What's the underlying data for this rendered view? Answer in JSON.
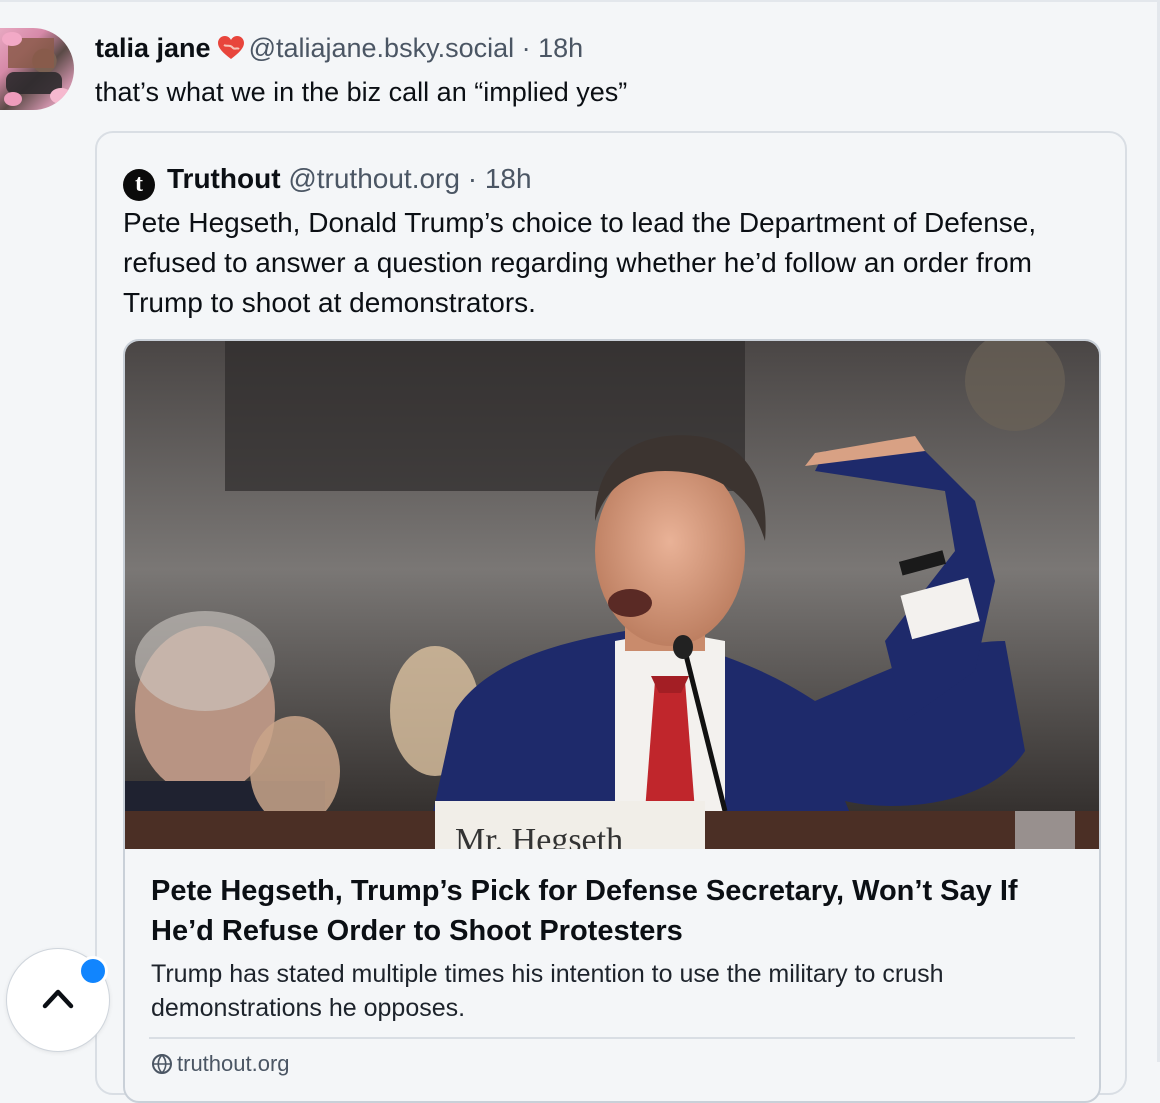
{
  "post": {
    "display_name": "talia jane",
    "handle": "@taliajane.bsky.social",
    "separator": "·",
    "time": "18h",
    "text": "that’s what we in the biz call an “implied yes”"
  },
  "quote": {
    "avatar_letter": "t",
    "display_name": "Truthout",
    "handle": "@truthout.org",
    "separator": "·",
    "time": "18h",
    "text": "Pete Hegseth, Donald Trump’s choice to lead the Department of Defense, refused to answer a question regarding whether he’d follow an order from Trump to shoot at demonstrators."
  },
  "link_card": {
    "image_placard_text": "Mr. Hegseth",
    "title": "Pete Hegseth, Trump’s Pick for Defense Secretary, Won’t Say If He’d Refuse Order to Shoot Protesters",
    "description": "Trump has stated multiple times his intention to use the military to crush demonstrations he opposes.",
    "domain": "truthout.org"
  },
  "icons": {
    "heart": "heart-icon",
    "globe": "globe-icon",
    "scroll_up": "chevron-up-icon"
  },
  "colors": {
    "accent": "#1185fe",
    "handle": "#4b5664",
    "background": "#f4f6f8",
    "border": "#d9dee4"
  }
}
